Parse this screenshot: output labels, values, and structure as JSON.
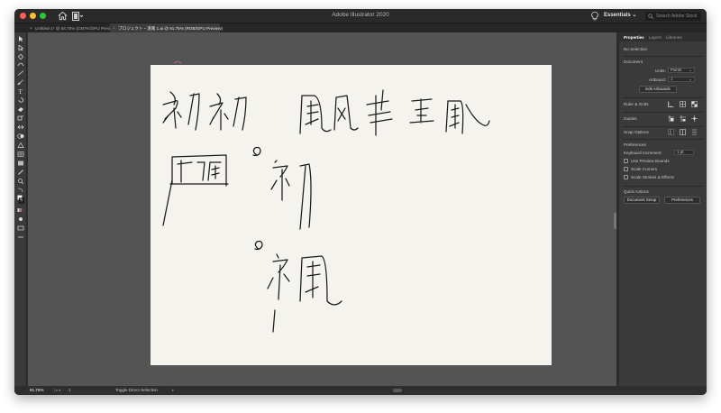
{
  "app_title": "Adobe Illustrator 2020",
  "workspace": "Essentials",
  "search_placeholder": "Search Adobe Stock",
  "tabs": [
    {
      "label": "Untitled-1* @ 66.75% (CMYK/GPU Preview)"
    },
    {
      "label": "プロジェクト・漢風 1.ai @ 91.75% (RGB/GPU Preview)"
    }
  ],
  "status": {
    "zoom": "91.76%",
    "nav_arrows": "|◂ ◂",
    "page": "1",
    "tool": "Toggle Direct Selection",
    "arrow": "▸"
  },
  "panel": {
    "tabs": [
      "Properties",
      "Layers",
      "Libraries"
    ],
    "no_selection": "No Selection",
    "document": "Document",
    "units_label": "Units:",
    "units_value": "Points",
    "artboard_label": "Artboard:",
    "artboard_value": "1",
    "edit_artboards": "Edit Artboards",
    "ruler_grids": "Ruler & Grids",
    "guides": "Guides",
    "snap_options": "Snap Options",
    "preferences_heading": "Preferences",
    "keyboard_increment": "Keyboard Increment:",
    "keyboard_increment_value": "1 pt",
    "use_preview_bounds": "Use Preview Bounds",
    "scale_corners": "Scale Corners",
    "scale_strokes": "Scale Strokes & Effects",
    "quick_actions": "Quick Actions",
    "document_setup": "Document Setup",
    "preferences_btn": "Preferences"
  },
  "colors": {
    "accent_close": "#ff5f57",
    "accent_min": "#febc2e",
    "accent_max": "#28c840",
    "canvas_bg": "#545454",
    "artboard": "#f4f3ee",
    "ink": "#1a1a1a"
  }
}
